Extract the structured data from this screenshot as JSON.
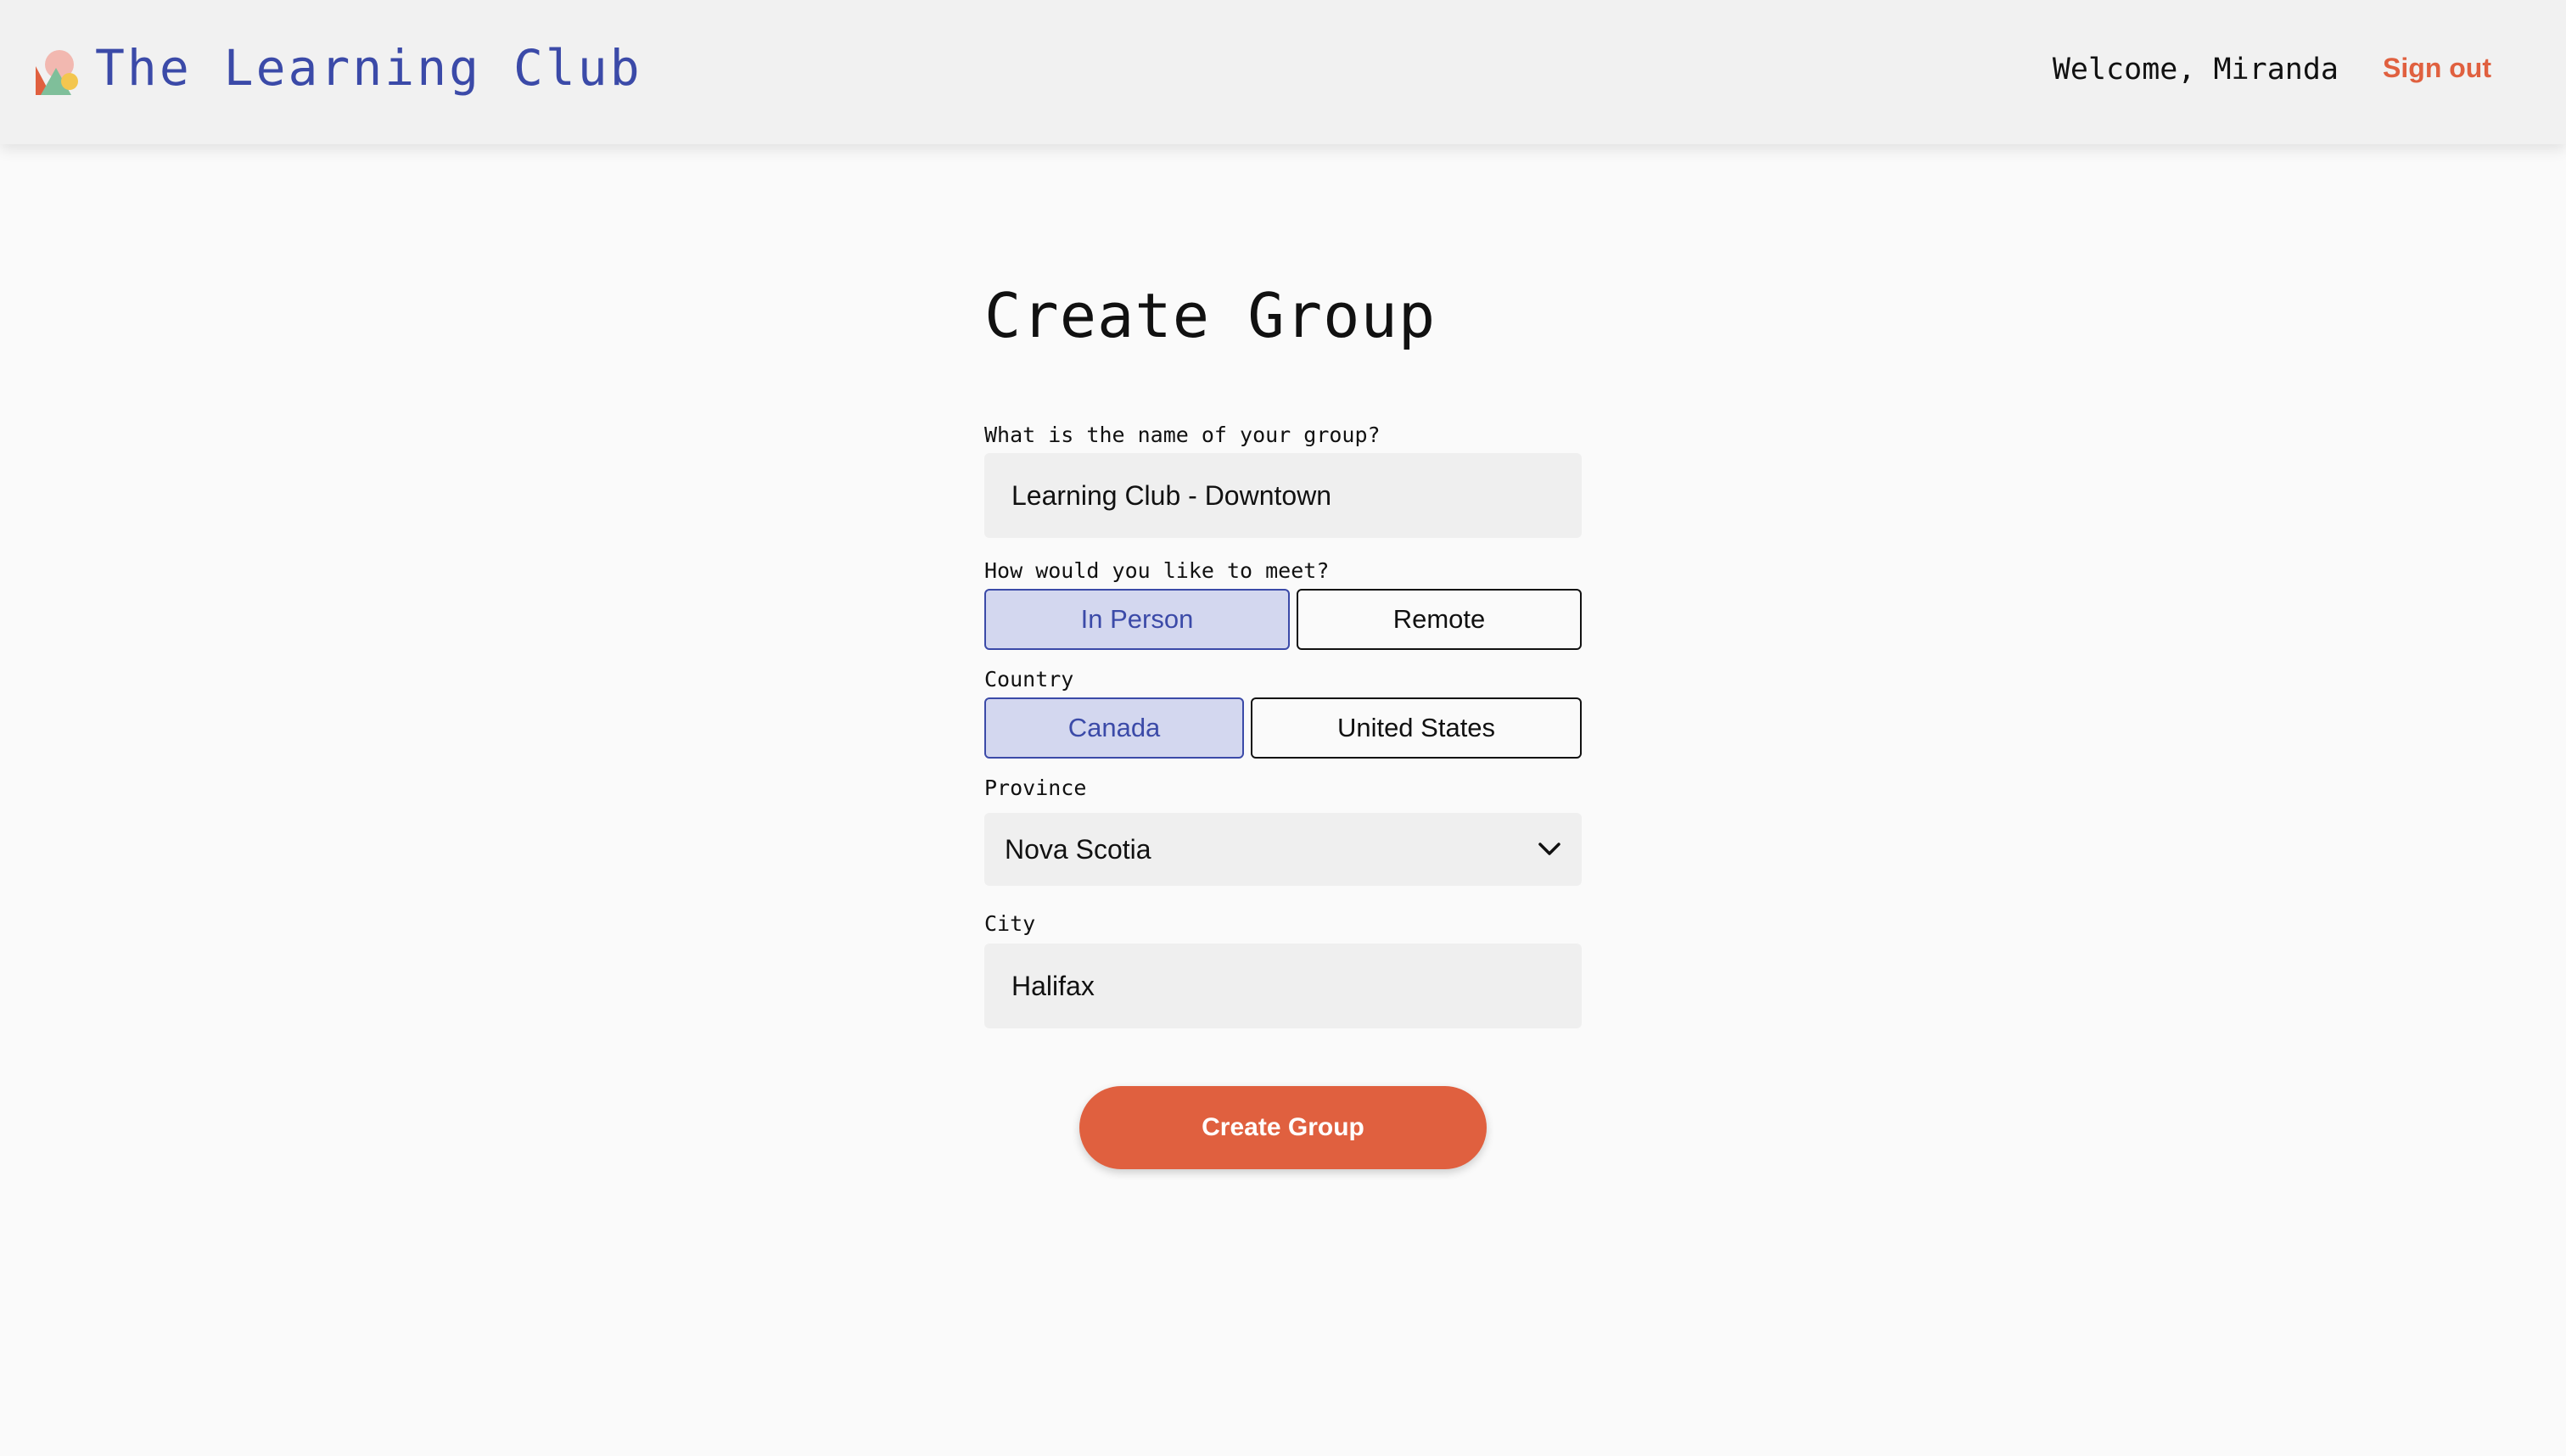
{
  "header": {
    "brand": "The Learning Club",
    "logo_icon": "learning-club-logo",
    "welcome": "Welcome, Miranda",
    "sign_out": "Sign out"
  },
  "form": {
    "title": "Create Group",
    "name_label": "What is the name of your group?",
    "name_value": "Learning Club - Downtown",
    "meet_label": "How would you like to meet?",
    "meet_options": [
      "In Person",
      "Remote"
    ],
    "meet_selected": "In Person",
    "country_label": "Country",
    "country_options": [
      "Canada",
      "United States"
    ],
    "country_selected": "Canada",
    "province_label": "Province",
    "province_value": "Nova Scotia",
    "city_label": "City",
    "city_value": "Halifax",
    "submit_label": "Create Group"
  },
  "colors": {
    "accent": "#e0603f",
    "brand_blue": "#3b4aa8",
    "selected_bg": "#d3d7ef"
  }
}
